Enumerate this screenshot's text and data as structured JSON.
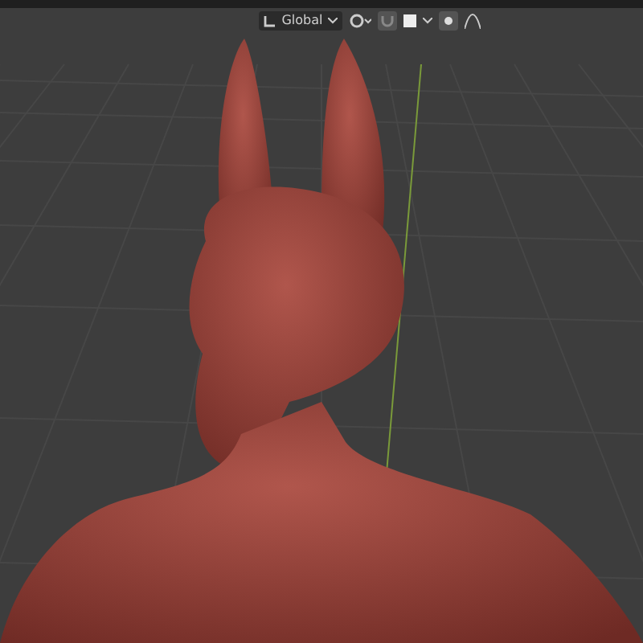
{
  "header": {
    "transform_orientation": {
      "label": "Global"
    },
    "snapping": {
      "on": false
    }
  }
}
